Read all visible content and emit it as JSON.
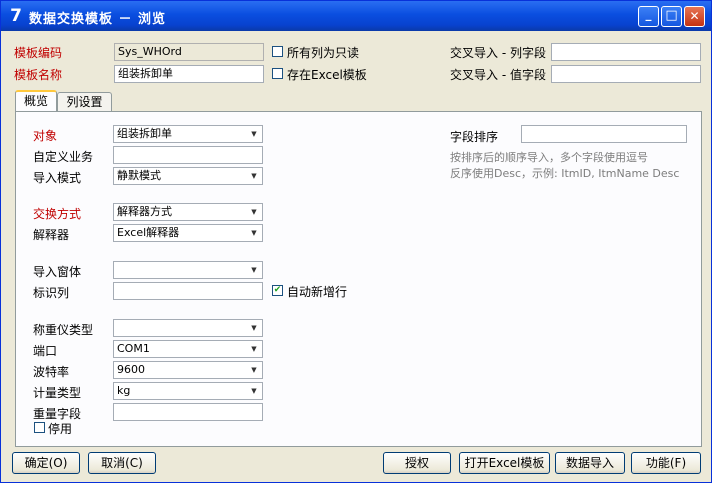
{
  "window": {
    "app_icon_glyph": "7",
    "title": "数据交换模板  －  浏览",
    "minimize_glyph": "_",
    "maximize_glyph": "□",
    "close_glyph": "✕"
  },
  "header": {
    "template_code_label": "模板编码",
    "template_code_value": "Sys_WHOrd",
    "template_name_label": "模板名称",
    "template_name_value": "组装拆卸单",
    "all_cols_readonly_label": "所有列为只读",
    "all_cols_readonly_checked": false,
    "excel_template_label": "存在Excel模板",
    "excel_template_checked": false,
    "cross_col_field_label": "交叉导入 - 列字段",
    "cross_col_field_value": "",
    "cross_val_field_label": "交叉导入 - 值字段",
    "cross_val_field_value": ""
  },
  "tabs": [
    {
      "label": "概览",
      "active": true
    },
    {
      "label": "列设置",
      "active": false
    }
  ],
  "overview": {
    "object_label": "对象",
    "object_value": "组装拆卸单",
    "custom_business_label": "自定义业务",
    "custom_business_value": "",
    "import_mode_label": "导入模式",
    "import_mode_value": "静默模式",
    "exchange_method_label": "交换方式",
    "exchange_method_value": "解释器方式",
    "parser_label": "解释器",
    "parser_value": "Excel解释器",
    "import_window_label": "导入窗体",
    "import_window_value": "",
    "id_column_label": "标识列",
    "id_column_value": "",
    "auto_add_row_label": "自动新增行",
    "auto_add_row_checked": true,
    "scale_type_label": "称重仪类型",
    "scale_type_value": "",
    "port_label": "端口",
    "port_value": "COM1",
    "baud_rate_label": "波特率",
    "baud_rate_value": "9600",
    "unit_type_label": "计量类型",
    "unit_type_value": "kg",
    "weight_field_label": "重量字段",
    "weight_field_value": "",
    "disabled_label": "停用",
    "disabled_checked": false,
    "field_sort_label": "字段排序",
    "field_sort_value": "",
    "field_sort_hint_1": "按排序后的顺序导入，多个字段使用逗号",
    "field_sort_hint_2": "反序使用Desc，示例: ItmID, ItmName Desc"
  },
  "footer": {
    "ok": "确定(O)",
    "cancel": "取消(C)",
    "authorize": "授权",
    "open_excel": "打开Excel模板",
    "data_import": "数据导入",
    "functions": "功能(F)"
  },
  "icons": {
    "dropdown": "chevron-down-icon",
    "check": "checkmark-icon"
  },
  "colors": {
    "required_label": "#c00000",
    "titlebar": "#0a4ee0"
  }
}
